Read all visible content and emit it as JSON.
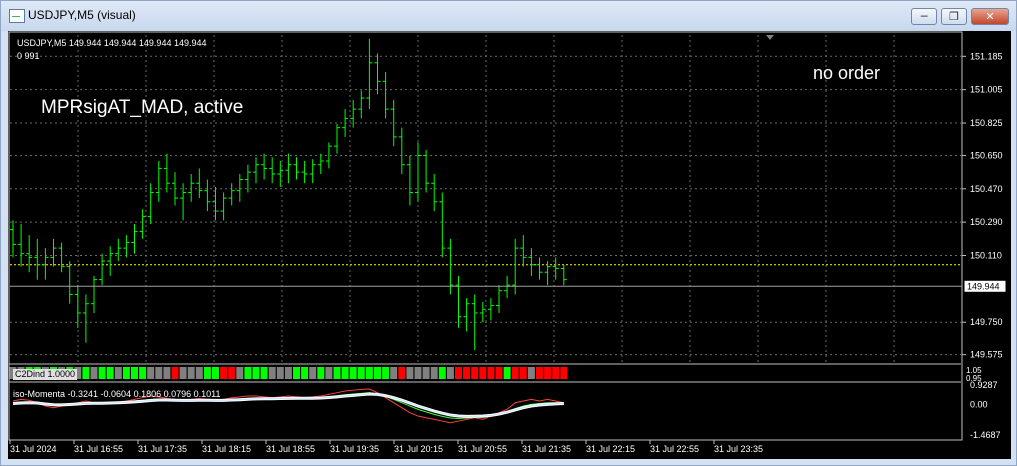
{
  "window": {
    "title": "USDJPY,M5 (visual)",
    "buttons": [
      "minimize",
      "restore",
      "close"
    ]
  },
  "header": {
    "symbol_line": "USDJPY,M5  149.944 149.944 149.944 149.944",
    "info_line": "0  991"
  },
  "overlay": {
    "ea_status": "MPRsigAT_MAD, active",
    "order_status": "no order"
  },
  "price_axis": {
    "labels": [
      "151.185",
      "151.005",
      "150.825",
      "150.650",
      "150.470",
      "150.290",
      "150.110",
      "149.750",
      "149.575"
    ],
    "current_price": "149.944",
    "colors": {
      "bull": "#00ff00",
      "grid": "#7a7a7a",
      "dotted_level": "#ffff00",
      "price_box": "#ffffff"
    }
  },
  "indicators": {
    "c2d": {
      "label": "C2Dind 1.0000",
      "scale_top": "1.05",
      "scale_bottom": "0.95",
      "colors": {
        "up": "#00ff00",
        "down": "#ff0000",
        "neutral": "#808080"
      },
      "states": [
        "g",
        "g",
        "u",
        "u",
        "g",
        "u",
        "g",
        "u",
        "g",
        "u",
        "g",
        "u",
        "u",
        "g",
        "u",
        "u",
        "u",
        "g",
        "g",
        "g",
        "d",
        "g",
        "g",
        "g",
        "u",
        "u",
        "d",
        "d",
        "g",
        "u",
        "u",
        "u",
        "g",
        "g",
        "g",
        "u",
        "u",
        "g",
        "u",
        "g",
        "u",
        "u",
        "u",
        "u",
        "u",
        "u",
        "u",
        "g",
        "d",
        "g",
        "g",
        "g",
        "g",
        "u",
        "g",
        "d",
        "d",
        "d",
        "d",
        "d",
        "d",
        "u",
        "d",
        "d",
        "g",
        "d",
        "d",
        "d",
        "d",
        "d",
        "d",
        "d",
        "g",
        "d",
        "d",
        "g",
        "g",
        "g",
        "g",
        "g",
        "d",
        "u",
        "d",
        "g",
        "d",
        "d",
        "g",
        "u",
        "g",
        "u",
        "g",
        "d",
        "d",
        "g",
        "d",
        "d"
      ]
    },
    "momentum": {
      "label": "iso-Momenta -0.3241 -0.0604 0.1806 0.0796 0.1011",
      "scale_top": "0.9287",
      "scale_zero": "0.00",
      "scale_bottom": "-1.4687"
    }
  },
  "time_axis": {
    "labels": [
      "31 Jul 2024",
      "31 Jul 16:55",
      "31 Jul 17:35",
      "31 Jul 18:15",
      "31 Jul 18:55",
      "31 Jul 19:35",
      "31 Jul 20:15",
      "31 Jul 20:55",
      "31 Jul 21:35",
      "31 Jul 22:15",
      "31 Jul 22:55",
      "31 Jul 23:35"
    ]
  },
  "chart_data": {
    "type": "candlestick",
    "symbol": "USDJPY",
    "timeframe": "M5",
    "y_range": [
      149.53,
      151.3
    ],
    "current_price": 149.944,
    "dotted_level": 150.06,
    "ohlc": [
      [
        150.25,
        150.3,
        150.1,
        150.17
      ],
      [
        150.17,
        150.28,
        150.05,
        150.12
      ],
      [
        150.12,
        150.22,
        150.02,
        150.1
      ],
      [
        150.1,
        150.2,
        149.98,
        150.06
      ],
      [
        150.06,
        150.15,
        149.98,
        150.1
      ],
      [
        150.1,
        150.2,
        150.05,
        150.15
      ],
      [
        150.15,
        150.18,
        150.02,
        150.05
      ],
      [
        150.05,
        150.08,
        149.85,
        149.9
      ],
      [
        149.9,
        149.95,
        149.72,
        149.8
      ],
      [
        149.8,
        149.9,
        149.64,
        149.85
      ],
      [
        149.85,
        150.0,
        149.8,
        149.98
      ],
      [
        149.98,
        150.12,
        149.95,
        150.08
      ],
      [
        150.08,
        150.16,
        150.0,
        150.12
      ],
      [
        150.12,
        150.2,
        150.08,
        150.15
      ],
      [
        150.15,
        150.22,
        150.1,
        150.18
      ],
      [
        150.18,
        150.28,
        150.12,
        150.24
      ],
      [
        150.24,
        150.36,
        150.2,
        150.32
      ],
      [
        150.32,
        150.5,
        150.28,
        150.45
      ],
      [
        150.45,
        150.62,
        150.4,
        150.58
      ],
      [
        150.58,
        150.66,
        150.45,
        150.5
      ],
      [
        150.5,
        150.56,
        150.38,
        150.42
      ],
      [
        150.42,
        150.5,
        150.3,
        150.45
      ],
      [
        150.45,
        150.55,
        150.4,
        150.5
      ],
      [
        150.5,
        150.58,
        150.42,
        150.46
      ],
      [
        150.46,
        150.52,
        150.35,
        150.4
      ],
      [
        150.4,
        150.48,
        150.3,
        150.35
      ],
      [
        150.35,
        150.45,
        150.3,
        150.42
      ],
      [
        150.42,
        150.5,
        150.38,
        150.46
      ],
      [
        150.46,
        150.55,
        150.4,
        150.52
      ],
      [
        150.52,
        150.6,
        150.45,
        150.56
      ],
      [
        150.56,
        150.64,
        150.5,
        150.6
      ],
      [
        150.6,
        150.66,
        150.52,
        150.58
      ],
      [
        150.58,
        150.64,
        150.5,
        150.55
      ],
      [
        150.55,
        150.62,
        150.48,
        150.57
      ],
      [
        150.57,
        150.66,
        150.5,
        150.6
      ],
      [
        150.6,
        150.64,
        150.52,
        150.56
      ],
      [
        150.56,
        150.62,
        150.5,
        150.55
      ],
      [
        150.55,
        150.63,
        150.5,
        150.6
      ],
      [
        150.6,
        150.66,
        150.55,
        150.62
      ],
      [
        150.62,
        150.72,
        150.58,
        150.7
      ],
      [
        150.7,
        150.82,
        150.66,
        150.8
      ],
      [
        150.8,
        150.9,
        150.75,
        150.85
      ],
      [
        150.85,
        150.95,
        150.8,
        150.9
      ],
      [
        150.9,
        151.0,
        150.85,
        150.96
      ],
      [
        150.96,
        151.28,
        150.9,
        151.15
      ],
      [
        151.15,
        151.2,
        150.98,
        151.05
      ],
      [
        151.05,
        151.1,
        150.85,
        150.9
      ],
      [
        150.9,
        150.95,
        150.7,
        150.75
      ],
      [
        150.75,
        150.8,
        150.55,
        150.6
      ],
      [
        150.6,
        150.65,
        150.38,
        150.45
      ],
      [
        150.45,
        150.72,
        150.4,
        150.65
      ],
      [
        150.65,
        150.68,
        150.45,
        150.5
      ],
      [
        150.5,
        150.55,
        150.35,
        150.4
      ],
      [
        150.4,
        150.45,
        150.1,
        150.15
      ],
      [
        150.15,
        150.2,
        149.9,
        149.95
      ],
      [
        149.95,
        150.0,
        149.72,
        149.78
      ],
      [
        149.78,
        149.88,
        149.7,
        149.85
      ],
      [
        149.85,
        149.9,
        149.6,
        149.8
      ],
      [
        149.8,
        149.86,
        149.75,
        149.82
      ],
      [
        149.82,
        149.88,
        149.76,
        149.84
      ],
      [
        149.84,
        149.95,
        149.8,
        149.92
      ],
      [
        149.92,
        150.0,
        149.88,
        149.95
      ],
      [
        149.95,
        150.2,
        149.9,
        150.15
      ],
      [
        150.15,
        150.22,
        150.05,
        150.1
      ],
      [
        150.1,
        150.15,
        150.0,
        150.06
      ],
      [
        150.06,
        150.1,
        149.98,
        150.02
      ],
      [
        150.02,
        150.08,
        149.95,
        150.05
      ],
      [
        150.05,
        150.1,
        149.98,
        150.04
      ],
      [
        150.04,
        150.06,
        149.95,
        149.98
      ]
    ],
    "x_labels": [
      "31 Jul 2024",
      "31 Jul 16:55",
      "31 Jul 17:35",
      "31 Jul 18:15",
      "31 Jul 18:55",
      "31 Jul 19:35",
      "31 Jul 20:15",
      "31 Jul 20:55",
      "31 Jul 21:35",
      "31 Jul 22:15",
      "31 Jul 22:55",
      "31 Jul 23:35"
    ],
    "momentum_series": [
      {
        "values": [
          0.2,
          0.3,
          0.25,
          0.1,
          -0.1,
          -0.2,
          -0.1,
          0.0,
          0.1,
          0.2,
          0.1,
          0.05,
          0.1,
          0.15,
          0.2,
          0.3,
          0.4,
          0.5,
          0.45,
          0.35,
          0.3,
          0.25,
          0.3,
          0.35,
          0.3,
          0.25,
          0.3,
          0.4,
          0.45,
          0.5,
          0.5,
          0.45,
          0.4,
          0.45,
          0.5,
          0.45,
          0.4,
          0.45,
          0.5,
          0.6,
          0.7,
          0.8,
          0.85,
          0.9,
          0.92,
          0.7,
          0.4,
          0.1,
          -0.2,
          -0.5,
          -0.7,
          -0.8,
          -0.9,
          -1.0,
          -1.1,
          -1.0,
          -0.9,
          -0.8,
          -0.9,
          -0.7,
          -0.5,
          -0.3,
          0.1,
          0.2,
          0.3,
          0.2,
          0.3,
          0.2,
          0.1
        ]
      },
      {
        "values": [
          0.1,
          0.15,
          0.15,
          0.1,
          0.0,
          -0.05,
          -0.05,
          0.0,
          0.05,
          0.1,
          0.1,
          0.08,
          0.1,
          0.12,
          0.15,
          0.2,
          0.25,
          0.3,
          0.32,
          0.3,
          0.28,
          0.26,
          0.27,
          0.29,
          0.28,
          0.26,
          0.27,
          0.3,
          0.33,
          0.36,
          0.38,
          0.38,
          0.37,
          0.38,
          0.4,
          0.4,
          0.39,
          0.4,
          0.42,
          0.46,
          0.52,
          0.58,
          0.62,
          0.66,
          0.7,
          0.62,
          0.48,
          0.3,
          0.1,
          -0.1,
          -0.3,
          -0.45,
          -0.6,
          -0.72,
          -0.82,
          -0.85,
          -0.82,
          -0.78,
          -0.78,
          -0.7,
          -0.58,
          -0.44,
          -0.25,
          -0.1,
          0.0,
          0.05,
          0.1,
          0.1,
          0.08
        ]
      },
      {
        "values": [
          0.05,
          0.08,
          0.1,
          0.08,
          0.02,
          -0.02,
          -0.03,
          -0.01,
          0.02,
          0.06,
          0.07,
          0.07,
          0.08,
          0.1,
          0.12,
          0.15,
          0.19,
          0.23,
          0.26,
          0.26,
          0.25,
          0.24,
          0.24,
          0.25,
          0.25,
          0.24,
          0.24,
          0.26,
          0.28,
          0.31,
          0.33,
          0.34,
          0.34,
          0.35,
          0.36,
          0.37,
          0.37,
          0.37,
          0.38,
          0.41,
          0.45,
          0.5,
          0.54,
          0.58,
          0.62,
          0.6,
          0.52,
          0.4,
          0.25,
          0.08,
          -0.1,
          -0.25,
          -0.4,
          -0.53,
          -0.64,
          -0.7,
          -0.72,
          -0.71,
          -0.7,
          -0.66,
          -0.58,
          -0.47,
          -0.33,
          -0.2,
          -0.1,
          -0.04,
          0.0,
          0.03,
          0.05
        ]
      }
    ]
  }
}
